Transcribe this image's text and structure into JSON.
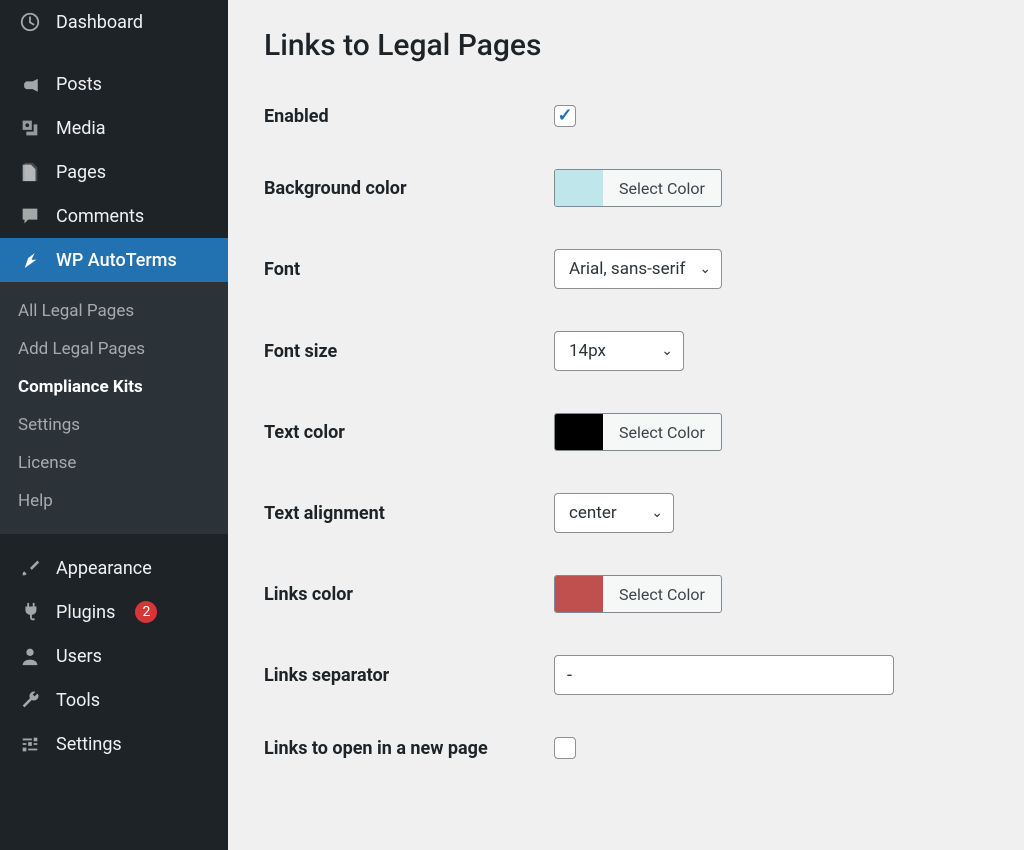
{
  "sidebar": {
    "dashboard": "Dashboard",
    "posts": "Posts",
    "media": "Media",
    "pages": "Pages",
    "comments": "Comments",
    "wpat": "WP AutoTerms",
    "appearance": "Appearance",
    "plugins": "Plugins",
    "plugins_badge": "2",
    "users": "Users",
    "tools": "Tools",
    "settings": "Settings",
    "sub": {
      "all": "All Legal Pages",
      "add": "Add Legal Pages",
      "kits": "Compliance Kits",
      "settings": "Settings",
      "license": "License",
      "help": "Help"
    }
  },
  "page": {
    "title": "Links to Legal Pages"
  },
  "form": {
    "enabled": {
      "label": "Enabled"
    },
    "bg_color": {
      "label": "Background color",
      "swatch": "#bfe6eb",
      "btn": "Select Color"
    },
    "font": {
      "label": "Font",
      "value": "Arial, sans-serif"
    },
    "font_size": {
      "label": "Font size",
      "value": "14px"
    },
    "text_color": {
      "label": "Text color",
      "swatch": "#000000",
      "btn": "Select Color"
    },
    "text_align": {
      "label": "Text alignment",
      "value": "center"
    },
    "links_color": {
      "label": "Links color",
      "swatch": "#c0504d",
      "btn": "Select Color"
    },
    "links_sep": {
      "label": "Links separator",
      "value": "-"
    },
    "new_page": {
      "label": "Links to open in a new page"
    }
  }
}
